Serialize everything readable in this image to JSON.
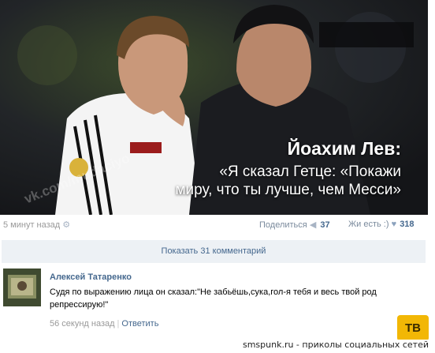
{
  "post": {
    "caption_name": "Йоахим Лев:",
    "caption_quote_line1": "«Я сказал Гетце: «Покажи",
    "caption_quote_line2": "миру, что ты лучше, чем Месси»",
    "watermark": "vk.com/mudaciyo"
  },
  "meta": {
    "time": "5 минут назад",
    "share_label": "Поделиться",
    "share_count": "37",
    "like_label": "Жи есть :)",
    "like_count": "318"
  },
  "show_comments_label": "Показать 31 комментарий",
  "comment": {
    "author": "Алексей Татаренко",
    "text_line1": "Судя по выражению лица он сказал:\"Не забьёшь,сука,гол-я тебя и весь твой род",
    "text_line2": "репрессирую!\"",
    "time": "56 секунд назад",
    "separator": "|",
    "reply_label": "Ответить"
  },
  "footer": {
    "badge": "TB",
    "site": "smspunk.ru - приколы социальных сетей"
  },
  "colors": {
    "link": "#45688e",
    "bar": "#edf1f5",
    "badge": "#f2b705"
  }
}
